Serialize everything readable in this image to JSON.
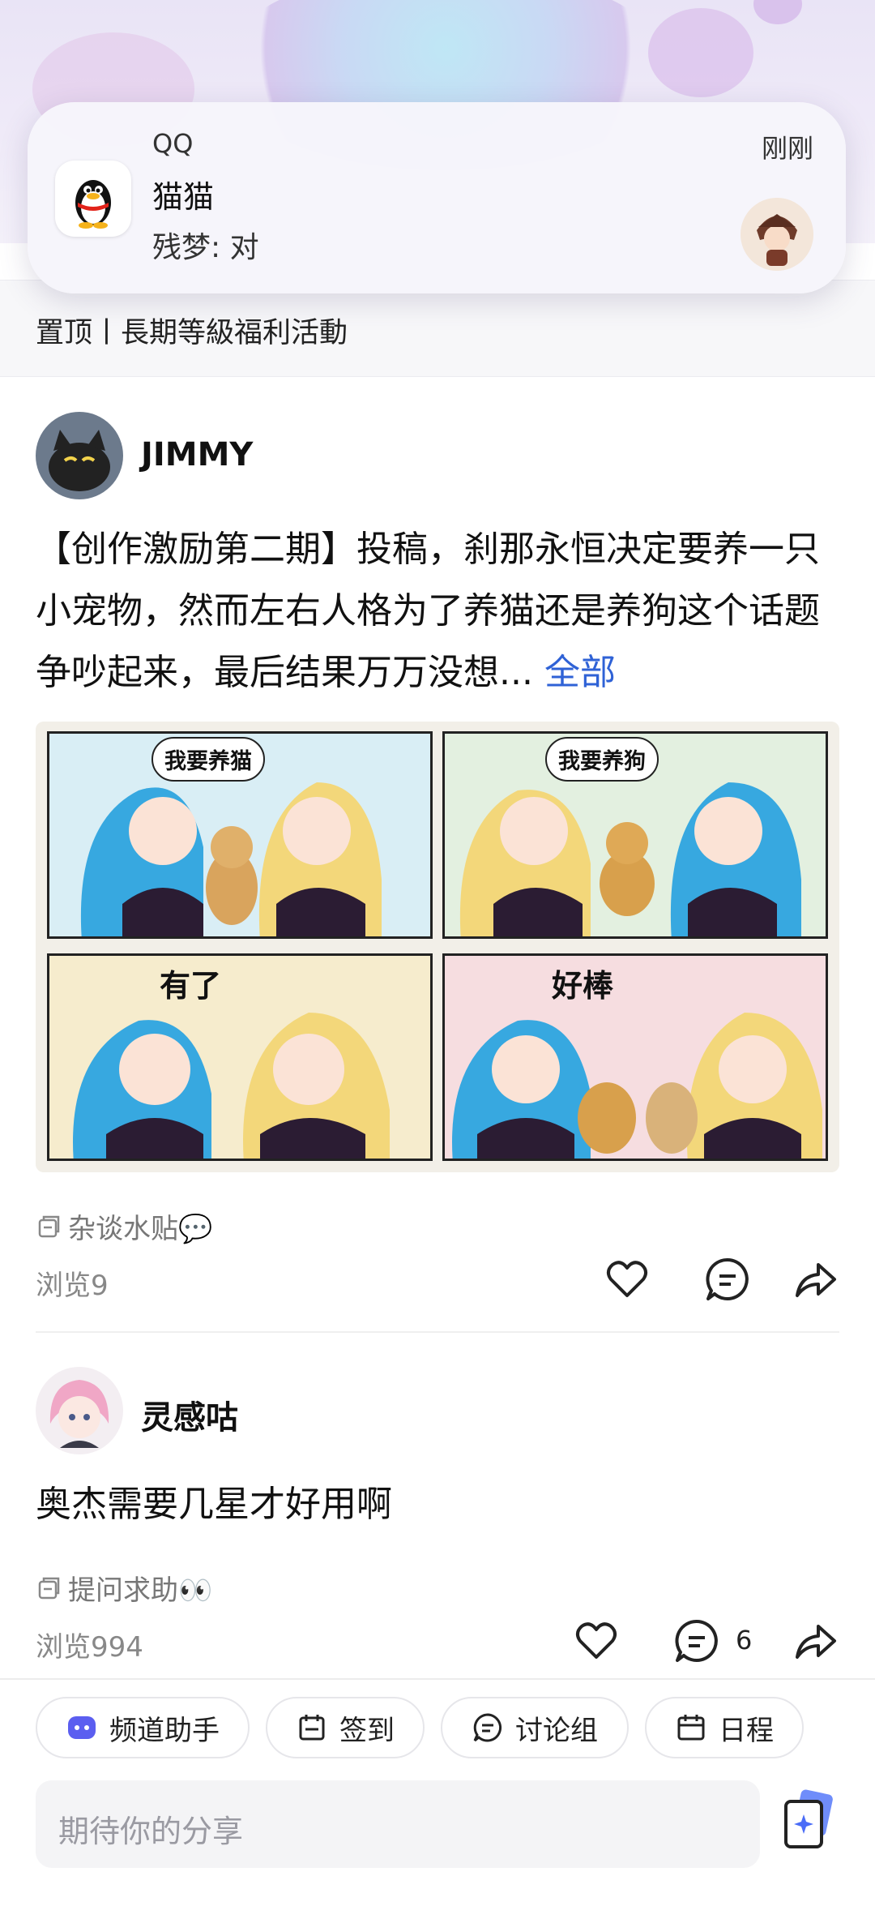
{
  "notification": {
    "app_name": "QQ",
    "time": "刚刚",
    "title": "猫猫",
    "message": "残梦: 对"
  },
  "pinned": {
    "label": "置顶丨長期等級福利活動"
  },
  "posts": [
    {
      "author": "JIMMY",
      "text": "【创作激励第二期】投稿，刹那永恒决定要养一只小宠物，然而左右人格为了养猫还是养狗这个话题争吵起来，最后结果万万没想...",
      "more_label": "全部",
      "comic_captions": [
        "我要养猫",
        "我要养狗",
        "有了",
        "好棒"
      ],
      "tag": "杂谈水贴💬",
      "views": "浏览9",
      "comment_count": ""
    },
    {
      "author": "灵感咕",
      "text": "奥杰需要几星才好用啊",
      "tag": "提问求助👀",
      "views": "浏览994",
      "comment_count": "6"
    }
  ],
  "shortcuts": [
    {
      "label": "频道助手",
      "icon": "assistant-icon"
    },
    {
      "label": "签到",
      "icon": "checkin-icon"
    },
    {
      "label": "讨论组",
      "icon": "discussion-icon"
    },
    {
      "label": "日程",
      "icon": "calendar-icon"
    }
  ],
  "composer": {
    "placeholder": "期待你的分享"
  },
  "colors": {
    "link": "#2f62d6",
    "muted": "#888888",
    "accent": "#4a5cf0"
  }
}
